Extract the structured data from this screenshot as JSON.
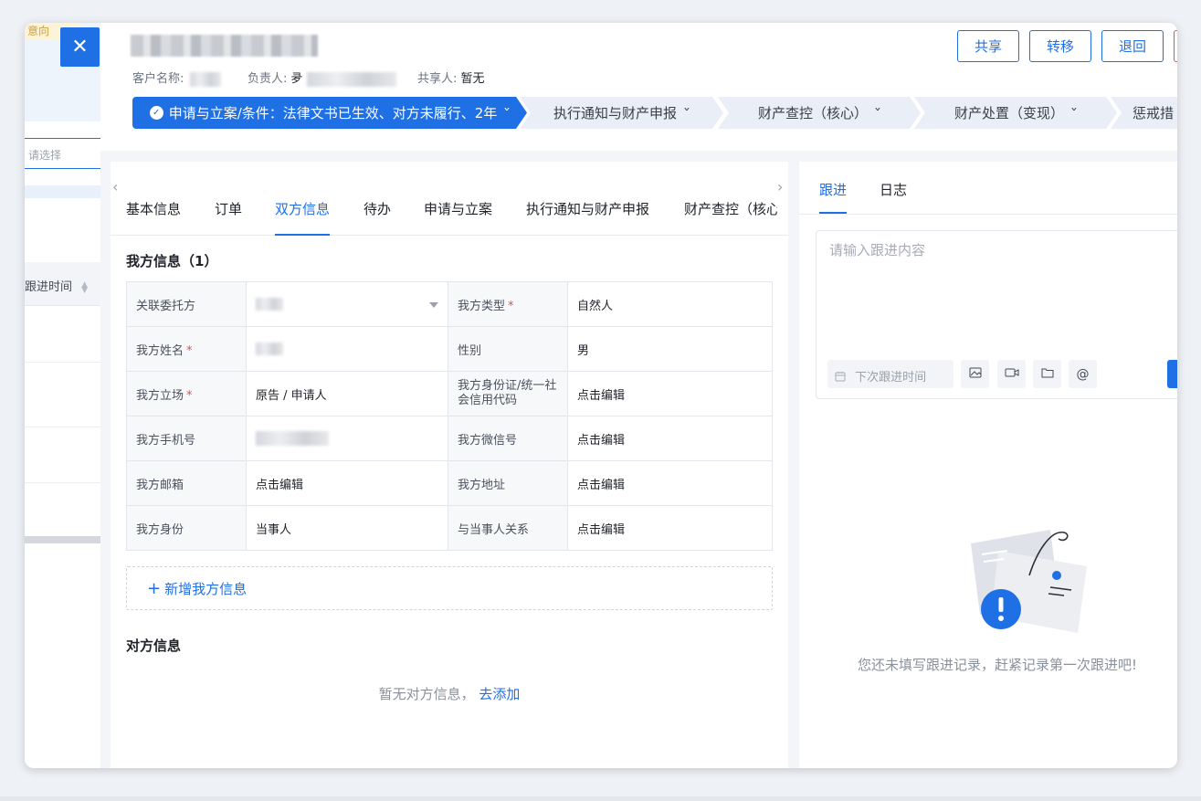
{
  "background": {
    "notice": "意向",
    "select_placeholder": "请选择",
    "column_header": "跟进时间"
  },
  "header": {
    "customer_label": "客户名称:",
    "owner_label": "负责人:",
    "owner_initial": "夛",
    "sharer_label": "共享人:",
    "sharer_value": "暂无",
    "buttons": {
      "share": "共享",
      "transfer": "转移",
      "return": "退回"
    }
  },
  "stages": [
    {
      "label": "申请与立案/条件：法律文书已生效、对方未履行、2年",
      "active": true
    },
    {
      "label": "执行通知与财产申报",
      "active": false
    },
    {
      "label": "财产查控（核心）",
      "active": false
    },
    {
      "label": "财产处置（变现）",
      "active": false
    },
    {
      "label": "惩戒措",
      "active": false
    }
  ],
  "tabs": [
    "基本信息",
    "订单",
    "双方信息",
    "待办",
    "申请与立案",
    "执行通知与财产申报",
    "财产查控（核心）"
  ],
  "our_info": {
    "title": "我方信息（1）",
    "rows": [
      {
        "l1": "关联委托方",
        "v1": "",
        "l2": "我方类型",
        "v2": "自然人"
      },
      {
        "l1": "我方姓名",
        "v1": "",
        "l2": "性别",
        "v2": "男"
      },
      {
        "l1": "我方立场",
        "v1": "原告 / 申请人",
        "l2": "我方身份证/统一社会信用代码",
        "v2": "点击编辑"
      },
      {
        "l1": "我方手机号",
        "v1": "",
        "l2": "我方微信号",
        "v2": "点击编辑"
      },
      {
        "l1": "我方邮箱",
        "v1": "点击编辑",
        "l2": "我方地址",
        "v2": "点击编辑"
      },
      {
        "l1": "我方身份",
        "v1": "当事人",
        "l2": "与当事人关系",
        "v2": "点击编辑"
      }
    ],
    "add_label": "新增我方信息"
  },
  "opponent_info": {
    "title": "对方信息",
    "empty_text": "暂无对方信息，",
    "add_link": "去添加"
  },
  "follow": {
    "tabs": [
      "跟进",
      "日志"
    ],
    "placeholder": "请输入跟进内容",
    "next_time_label": "下次跟进时间",
    "mention": "@",
    "empty_text": "您还未填写跟进记录，赶紧记录第一次跟进吧!"
  },
  "colors": {
    "primary": "#1f6fe5",
    "required": "#e05252"
  },
  "icons": [
    "close-icon",
    "check-circle-icon",
    "chevron-down-icon",
    "calendar-icon",
    "image-icon",
    "video-icon",
    "folder-icon",
    "at-icon",
    "alert-icon"
  ]
}
